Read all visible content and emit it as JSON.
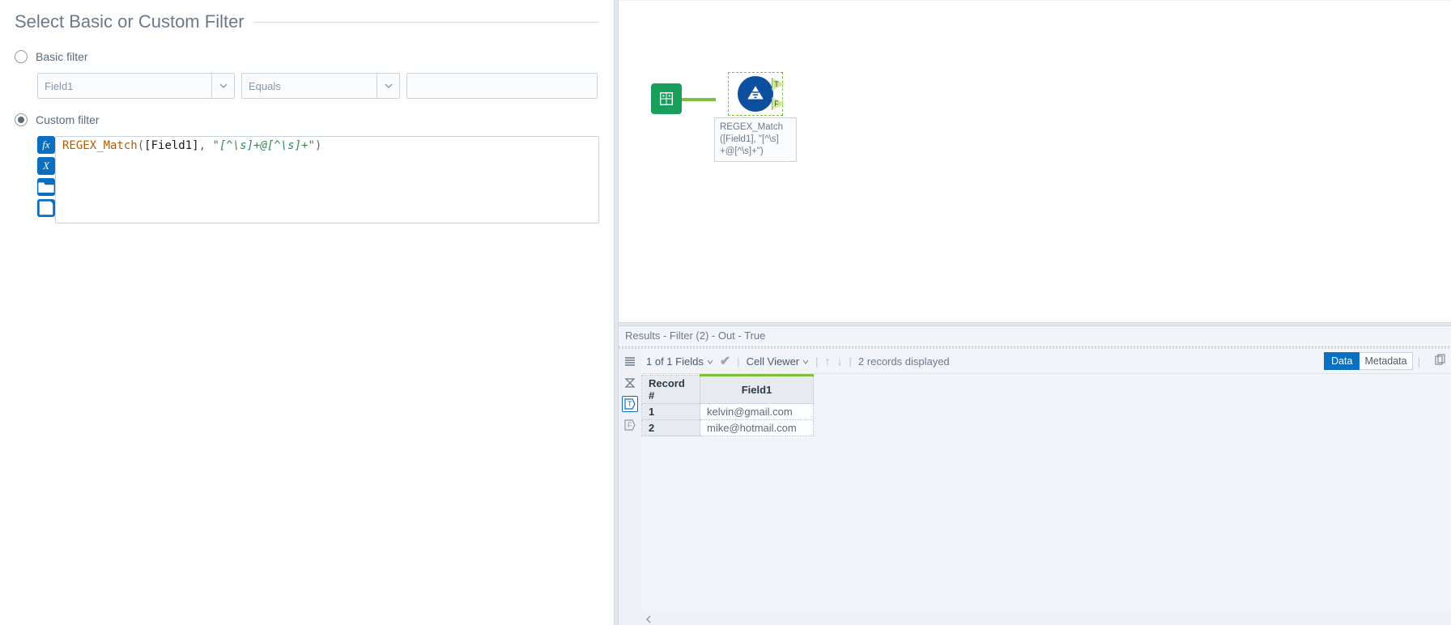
{
  "config": {
    "title": "Select Basic or Custom Filter",
    "basic_label": "Basic filter",
    "custom_label": "Custom filter",
    "basic_field": "Field1",
    "basic_op": "Equals",
    "basic_value": "",
    "expression_fn": "REGEX_Match",
    "expression_paren_open": "(",
    "expression_field": "[Field1]",
    "expression_comma": ", ",
    "expression_str": "\"[^\\s]+@[^\\s]+\"",
    "expression_paren_close": ")"
  },
  "canvas": {
    "filter_annotation_l1": "REGEX_Match",
    "filter_annotation_l2": "([Field1], \"[^\\s]",
    "filter_annotation_l3": "+@[^\\s]+\")",
    "port_t": "T",
    "port_f": "F"
  },
  "results": {
    "title": "Results - Filter (2) - Out - True",
    "fields_summary": "1 of 1 Fields",
    "cell_viewer": "Cell Viewer",
    "records_text": "2 records displayed",
    "tab_data": "Data",
    "tab_metadata": "Metadata",
    "columns": {
      "rec": "Record #",
      "field1": "Field1"
    },
    "rows": [
      {
        "n": "1",
        "field1": "kelvin@gmail.com"
      },
      {
        "n": "2",
        "field1": "mike@hotmail.com"
      }
    ]
  }
}
